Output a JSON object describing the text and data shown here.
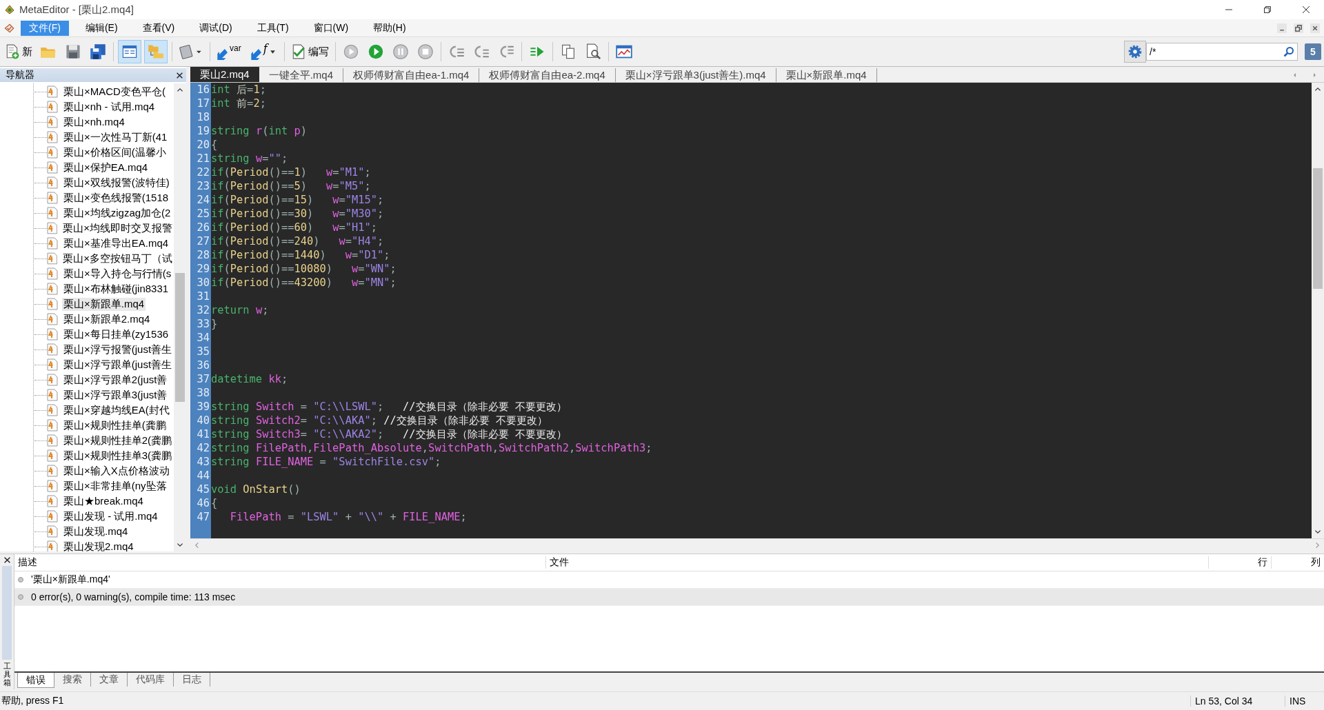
{
  "window": {
    "title": "MetaEditor - [栗山2.mq4]"
  },
  "menu": [
    {
      "label": "文件(F)",
      "selected": true
    },
    {
      "label": "编辑(E)",
      "selected": false
    },
    {
      "label": "查看(V)",
      "selected": false
    },
    {
      "label": "调试(D)",
      "selected": false
    },
    {
      "label": "工具(T)",
      "selected": false
    },
    {
      "label": "窗口(W)",
      "selected": false
    },
    {
      "label": "帮助(H)",
      "selected": false
    }
  ],
  "toolbar": {
    "new_label": "新",
    "insert_var_label": "var",
    "insert_func_label": "f",
    "compile_label": "编写",
    "navigator_pressed": true,
    "toolbox_pressed": true
  },
  "search": {
    "value": "/*"
  },
  "notifications": {
    "count": "5"
  },
  "navigator": {
    "title": "导航器",
    "items": [
      {
        "label": "栗山×MACD变色平仓(",
        "selected": false
      },
      {
        "label": "栗山×nh - 试用.mq4",
        "selected": false
      },
      {
        "label": "栗山×nh.mq4",
        "selected": false
      },
      {
        "label": "栗山×一次性马丁新(41",
        "selected": false
      },
      {
        "label": "栗山×价格区间(温馨小",
        "selected": false
      },
      {
        "label": "栗山×保护EA.mq4",
        "selected": false
      },
      {
        "label": "栗山×双线报警(波特佳)",
        "selected": false
      },
      {
        "label": "栗山×变色线报警(1518",
        "selected": false
      },
      {
        "label": "栗山×均线zigzag加仓(2",
        "selected": false
      },
      {
        "label": "栗山×均线即时交叉报警",
        "selected": false
      },
      {
        "label": "栗山×基准导出EA.mq4",
        "selected": false
      },
      {
        "label": "栗山×多空按钮马丁（试",
        "selected": false
      },
      {
        "label": "栗山×导入持仓与行情(s",
        "selected": false
      },
      {
        "label": "栗山×布林触碰(jin8331",
        "selected": false
      },
      {
        "label": "栗山×新跟单.mq4",
        "selected": true
      },
      {
        "label": "栗山×新跟单2.mq4",
        "selected": false
      },
      {
        "label": "栗山×每日挂单(zy1536",
        "selected": false
      },
      {
        "label": "栗山×浮亏报警(just善生",
        "selected": false
      },
      {
        "label": "栗山×浮亏跟单(just善生",
        "selected": false
      },
      {
        "label": "栗山×浮亏跟单2(just善",
        "selected": false
      },
      {
        "label": "栗山×浮亏跟单3(just善",
        "selected": false
      },
      {
        "label": "栗山×穿越均线EA(封代",
        "selected": false
      },
      {
        "label": "栗山×规则性挂单(龚鹏",
        "selected": false
      },
      {
        "label": "栗山×规则性挂单2(龚鹏",
        "selected": false
      },
      {
        "label": "栗山×规则性挂单3(龚鹏",
        "selected": false
      },
      {
        "label": "栗山×输入X点价格波动",
        "selected": false
      },
      {
        "label": "栗山×非常挂单(ny坠落",
        "selected": false
      },
      {
        "label": "栗山★break.mq4",
        "selected": false
      },
      {
        "label": "栗山发现 - 试用.mq4",
        "selected": false
      },
      {
        "label": "栗山发现.mq4",
        "selected": false
      },
      {
        "label": "栗山发现2.mq4",
        "selected": false
      }
    ]
  },
  "editor_tabs": [
    {
      "label": "栗山2.mq4",
      "selected": true
    },
    {
      "label": "一键全平.mq4",
      "selected": false
    },
    {
      "label": "权师傅财富自由ea-1.mq4",
      "selected": false
    },
    {
      "label": "权师傅财富自由ea-2.mq4",
      "selected": false
    },
    {
      "label": "栗山×浮亏跟单3(just善生).mq4",
      "selected": false
    },
    {
      "label": "栗山×新跟单.mq4",
      "selected": false
    }
  ],
  "code_lines": [
    {
      "number": "16",
      "tokens": [
        {
          "kind": "keyword",
          "text": "int"
        },
        {
          "kind": "plain",
          "text": " 后"
        },
        {
          "kind": "punct",
          "text": "="
        },
        {
          "kind": "number",
          "text": "1"
        },
        {
          "kind": "punct",
          "text": ";"
        }
      ]
    },
    {
      "number": "17",
      "tokens": [
        {
          "kind": "keyword",
          "text": "int"
        },
        {
          "kind": "plain",
          "text": " 前"
        },
        {
          "kind": "punct",
          "text": "="
        },
        {
          "kind": "number",
          "text": "2"
        },
        {
          "kind": "punct",
          "text": ";"
        }
      ]
    },
    {
      "number": "18"
    },
    {
      "number": "19",
      "tokens": [
        {
          "kind": "keyword",
          "text": "string "
        },
        {
          "kind": "ident",
          "text": "r"
        },
        {
          "kind": "punct",
          "text": "("
        },
        {
          "kind": "keyword",
          "text": "int "
        },
        {
          "kind": "ident",
          "text": "p"
        },
        {
          "kind": "punct",
          "text": ")"
        }
      ]
    },
    {
      "number": "20",
      "tokens": [
        {
          "kind": "punct",
          "text": "{"
        }
      ]
    },
    {
      "number": "21",
      "tokens": [
        {
          "kind": "keyword",
          "text": "string "
        },
        {
          "kind": "ident",
          "text": "w"
        },
        {
          "kind": "punct",
          "text": "="
        },
        {
          "kind": "string",
          "text": "\"\""
        },
        {
          "kind": "punct",
          "text": ";"
        }
      ]
    },
    {
      "number": "22",
      "tokens": [
        {
          "kind": "keyword",
          "text": "if"
        },
        {
          "kind": "punct",
          "text": "("
        },
        {
          "kind": "function",
          "text": "Period"
        },
        {
          "kind": "punct",
          "text": "()=="
        },
        {
          "kind": "number",
          "text": "1"
        },
        {
          "kind": "punct",
          "text": ")   "
        },
        {
          "kind": "ident",
          "text": "w"
        },
        {
          "kind": "punct",
          "text": "="
        },
        {
          "kind": "string",
          "text": "\"M1\""
        },
        {
          "kind": "punct",
          "text": ";"
        }
      ]
    },
    {
      "number": "23",
      "tokens": [
        {
          "kind": "keyword",
          "text": "if"
        },
        {
          "kind": "punct",
          "text": "("
        },
        {
          "kind": "function",
          "text": "Period"
        },
        {
          "kind": "punct",
          "text": "()=="
        },
        {
          "kind": "number",
          "text": "5"
        },
        {
          "kind": "punct",
          "text": ")   "
        },
        {
          "kind": "ident",
          "text": "w"
        },
        {
          "kind": "punct",
          "text": "="
        },
        {
          "kind": "string",
          "text": "\"M5\""
        },
        {
          "kind": "punct",
          "text": ";"
        }
      ]
    },
    {
      "number": "24",
      "tokens": [
        {
          "kind": "keyword",
          "text": "if"
        },
        {
          "kind": "punct",
          "text": "("
        },
        {
          "kind": "function",
          "text": "Period"
        },
        {
          "kind": "punct",
          "text": "()=="
        },
        {
          "kind": "number",
          "text": "15"
        },
        {
          "kind": "punct",
          "text": ")   "
        },
        {
          "kind": "ident",
          "text": "w"
        },
        {
          "kind": "punct",
          "text": "="
        },
        {
          "kind": "string",
          "text": "\"M15\""
        },
        {
          "kind": "punct",
          "text": ";"
        }
      ]
    },
    {
      "number": "25",
      "tokens": [
        {
          "kind": "keyword",
          "text": "if"
        },
        {
          "kind": "punct",
          "text": "("
        },
        {
          "kind": "function",
          "text": "Period"
        },
        {
          "kind": "punct",
          "text": "()=="
        },
        {
          "kind": "number",
          "text": "30"
        },
        {
          "kind": "punct",
          "text": ")   "
        },
        {
          "kind": "ident",
          "text": "w"
        },
        {
          "kind": "punct",
          "text": "="
        },
        {
          "kind": "string",
          "text": "\"M30\""
        },
        {
          "kind": "punct",
          "text": ";"
        }
      ]
    },
    {
      "number": "26",
      "tokens": [
        {
          "kind": "keyword",
          "text": "if"
        },
        {
          "kind": "punct",
          "text": "("
        },
        {
          "kind": "function",
          "text": "Period"
        },
        {
          "kind": "punct",
          "text": "()=="
        },
        {
          "kind": "number",
          "text": "60"
        },
        {
          "kind": "punct",
          "text": ")   "
        },
        {
          "kind": "ident",
          "text": "w"
        },
        {
          "kind": "punct",
          "text": "="
        },
        {
          "kind": "string",
          "text": "\"H1\""
        },
        {
          "kind": "punct",
          "text": ";"
        }
      ]
    },
    {
      "number": "27",
      "tokens": [
        {
          "kind": "keyword",
          "text": "if"
        },
        {
          "kind": "punct",
          "text": "("
        },
        {
          "kind": "function",
          "text": "Period"
        },
        {
          "kind": "punct",
          "text": "()=="
        },
        {
          "kind": "number",
          "text": "240"
        },
        {
          "kind": "punct",
          "text": ")   "
        },
        {
          "kind": "ident",
          "text": "w"
        },
        {
          "kind": "punct",
          "text": "="
        },
        {
          "kind": "string",
          "text": "\"H4\""
        },
        {
          "kind": "punct",
          "text": ";"
        }
      ]
    },
    {
      "number": "28",
      "tokens": [
        {
          "kind": "keyword",
          "text": "if"
        },
        {
          "kind": "punct",
          "text": "("
        },
        {
          "kind": "function",
          "text": "Period"
        },
        {
          "kind": "punct",
          "text": "()=="
        },
        {
          "kind": "number",
          "text": "1440"
        },
        {
          "kind": "punct",
          "text": ")   "
        },
        {
          "kind": "ident",
          "text": "w"
        },
        {
          "kind": "punct",
          "text": "="
        },
        {
          "kind": "string",
          "text": "\"D1\""
        },
        {
          "kind": "punct",
          "text": ";"
        }
      ]
    },
    {
      "number": "29",
      "tokens": [
        {
          "kind": "keyword",
          "text": "if"
        },
        {
          "kind": "punct",
          "text": "("
        },
        {
          "kind": "function",
          "text": "Period"
        },
        {
          "kind": "punct",
          "text": "()=="
        },
        {
          "kind": "number",
          "text": "10080"
        },
        {
          "kind": "punct",
          "text": ")   "
        },
        {
          "kind": "ident",
          "text": "w"
        },
        {
          "kind": "punct",
          "text": "="
        },
        {
          "kind": "string",
          "text": "\"WN\""
        },
        {
          "kind": "punct",
          "text": ";"
        }
      ]
    },
    {
      "number": "30",
      "tokens": [
        {
          "kind": "keyword",
          "text": "if"
        },
        {
          "kind": "punct",
          "text": "("
        },
        {
          "kind": "function",
          "text": "Period"
        },
        {
          "kind": "punct",
          "text": "()=="
        },
        {
          "kind": "number",
          "text": "43200"
        },
        {
          "kind": "punct",
          "text": ")   "
        },
        {
          "kind": "ident",
          "text": "w"
        },
        {
          "kind": "punct",
          "text": "="
        },
        {
          "kind": "string",
          "text": "\"MN\""
        },
        {
          "kind": "punct",
          "text": ";"
        }
      ]
    },
    {
      "number": "31"
    },
    {
      "number": "32",
      "tokens": [
        {
          "kind": "keyword",
          "text": "return "
        },
        {
          "kind": "ident",
          "text": "w"
        },
        {
          "kind": "punct",
          "text": ";"
        }
      ]
    },
    {
      "number": "33",
      "tokens": [
        {
          "kind": "punct",
          "text": "}"
        }
      ]
    },
    {
      "number": "34"
    },
    {
      "number": "35"
    },
    {
      "number": "36"
    },
    {
      "number": "37",
      "tokens": [
        {
          "kind": "keyword",
          "text": "datetime "
        },
        {
          "kind": "ident",
          "text": "kk"
        },
        {
          "kind": "punct",
          "text": ";"
        }
      ]
    },
    {
      "number": "38"
    },
    {
      "number": "39",
      "tokens": [
        {
          "kind": "keyword",
          "text": "string "
        },
        {
          "kind": "ident",
          "text": "Switch"
        },
        {
          "kind": "punct",
          "text": " = "
        },
        {
          "kind": "string",
          "text": "\"C:\\\\LSWL\""
        },
        {
          "kind": "punct",
          "text": ";   "
        },
        {
          "kind": "comment",
          "text": "//交换目录（除非必要 不要更改）"
        }
      ]
    },
    {
      "number": "40",
      "tokens": [
        {
          "kind": "keyword",
          "text": "string "
        },
        {
          "kind": "ident",
          "text": "Switch2"
        },
        {
          "kind": "punct",
          "text": "= "
        },
        {
          "kind": "string",
          "text": "\"C:\\\\AKA\""
        },
        {
          "kind": "punct",
          "text": "; "
        },
        {
          "kind": "comment",
          "text": "//交换目录（除非必要 不要更改）"
        }
      ]
    },
    {
      "number": "41",
      "tokens": [
        {
          "kind": "keyword",
          "text": "string "
        },
        {
          "kind": "ident",
          "text": "Switch3"
        },
        {
          "kind": "punct",
          "text": "= "
        },
        {
          "kind": "string",
          "text": "\"C:\\\\AKA2\""
        },
        {
          "kind": "punct",
          "text": ";   "
        },
        {
          "kind": "comment",
          "text": "//交换目录（除非必要 不要更改）"
        }
      ]
    },
    {
      "number": "42",
      "tokens": [
        {
          "kind": "keyword",
          "text": "string "
        },
        {
          "kind": "ident",
          "text": "FilePath"
        },
        {
          "kind": "punct",
          "text": ","
        },
        {
          "kind": "ident",
          "text": "FilePath_Absolute"
        },
        {
          "kind": "punct",
          "text": ","
        },
        {
          "kind": "ident",
          "text": "SwitchPath"
        },
        {
          "kind": "punct",
          "text": ","
        },
        {
          "kind": "ident",
          "text": "SwitchPath2"
        },
        {
          "kind": "punct",
          "text": ","
        },
        {
          "kind": "ident",
          "text": "SwitchPath3"
        },
        {
          "kind": "punct",
          "text": ";"
        }
      ]
    },
    {
      "number": "43",
      "tokens": [
        {
          "kind": "keyword",
          "text": "string "
        },
        {
          "kind": "ident",
          "text": "FILE_NAME"
        },
        {
          "kind": "punct",
          "text": " = "
        },
        {
          "kind": "string",
          "text": "\"SwitchFile.csv\""
        },
        {
          "kind": "punct",
          "text": ";"
        }
      ]
    },
    {
      "number": "44"
    },
    {
      "number": "45",
      "tokens": [
        {
          "kind": "keyword",
          "text": "void "
        },
        {
          "kind": "function",
          "text": "OnStart"
        },
        {
          "kind": "punct",
          "text": "()"
        }
      ]
    },
    {
      "number": "46",
      "tokens": [
        {
          "kind": "punct",
          "text": "{"
        }
      ]
    },
    {
      "number": "47",
      "tokens": [
        {
          "kind": "ident",
          "text": "   FilePath"
        },
        {
          "kind": "punct",
          "text": " = "
        },
        {
          "kind": "string",
          "text": "\"LSWL\""
        },
        {
          "kind": "punct",
          "text": " + "
        },
        {
          "kind": "string",
          "text": "\"\\\\\""
        },
        {
          "kind": "punct",
          "text": " + "
        },
        {
          "kind": "ident",
          "text": "FILE_NAME"
        },
        {
          "kind": "punct",
          "text": ";"
        }
      ]
    }
  ],
  "toolbox": {
    "side_label": "工具箱",
    "columns": [
      {
        "label": "描述"
      },
      {
        "label": "文件"
      },
      {
        "label": "行"
      },
      {
        "label": "列"
      }
    ],
    "rows": [
      {
        "description": "'栗山×新跟单.mq4'",
        "selected": false
      },
      {
        "description": "0 error(s), 0 warning(s), compile time: 113 msec",
        "selected": true
      }
    ],
    "tabs": [
      {
        "label": "错误",
        "selected": true
      },
      {
        "label": "搜索",
        "selected": false
      },
      {
        "label": "文章",
        "selected": false
      },
      {
        "label": "代码库",
        "selected": false
      },
      {
        "label": "日志",
        "selected": false
      }
    ]
  },
  "status_bar": {
    "help": "帮助, press F1",
    "position": "Ln 53, Col 34",
    "mode": "INS"
  }
}
